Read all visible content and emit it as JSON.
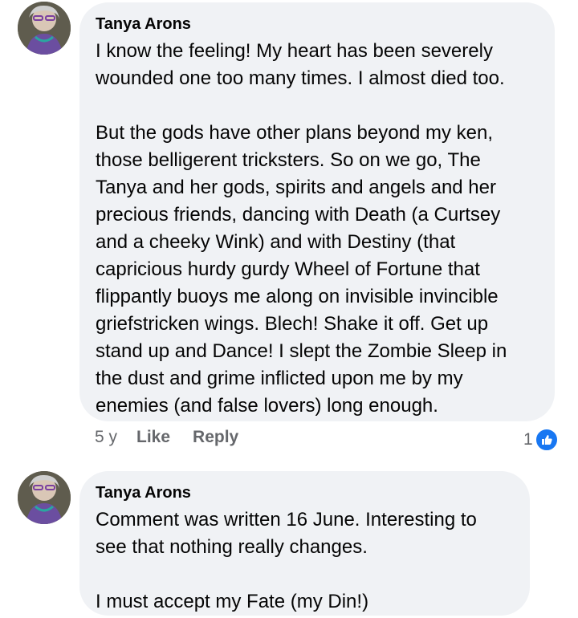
{
  "comments": [
    {
      "author": "Tanya Arons",
      "text": "I know the feeling!  My heart has been severely\nwounded one too many times. I almost died too.\n\nBut the gods have other plans beyond my ken,\nthose belligerent tricksters.  So on we go, The\nTanya and her gods, spirits and angels and her\nprecious friends, dancing with Death (a Curtsey\nand a cheeky Wink) and with Destiny (that\ncapricious hurdy gurdy Wheel of Fortune that\nflippantly buoys me along on invisible invincible\ngriefstricken wings.  Blech!  Shake it off. Get up\nstand up and Dance! I slept the Zombie Sleep in\nthe dust and grime inflicted upon me by my\nenemies (and false lovers) long enough.",
      "time": "5 y",
      "like_label": "Like",
      "reply_label": "Reply",
      "reaction_count": "1",
      "reaction_icon": "thumbs-up-icon",
      "reaction_color": "#1877f2"
    },
    {
      "author": "Tanya Arons",
      "text": "Comment was written 16 June.  Interesting to\nsee that nothing really changes.\n\nI must accept my Fate (my Din!)"
    }
  ]
}
